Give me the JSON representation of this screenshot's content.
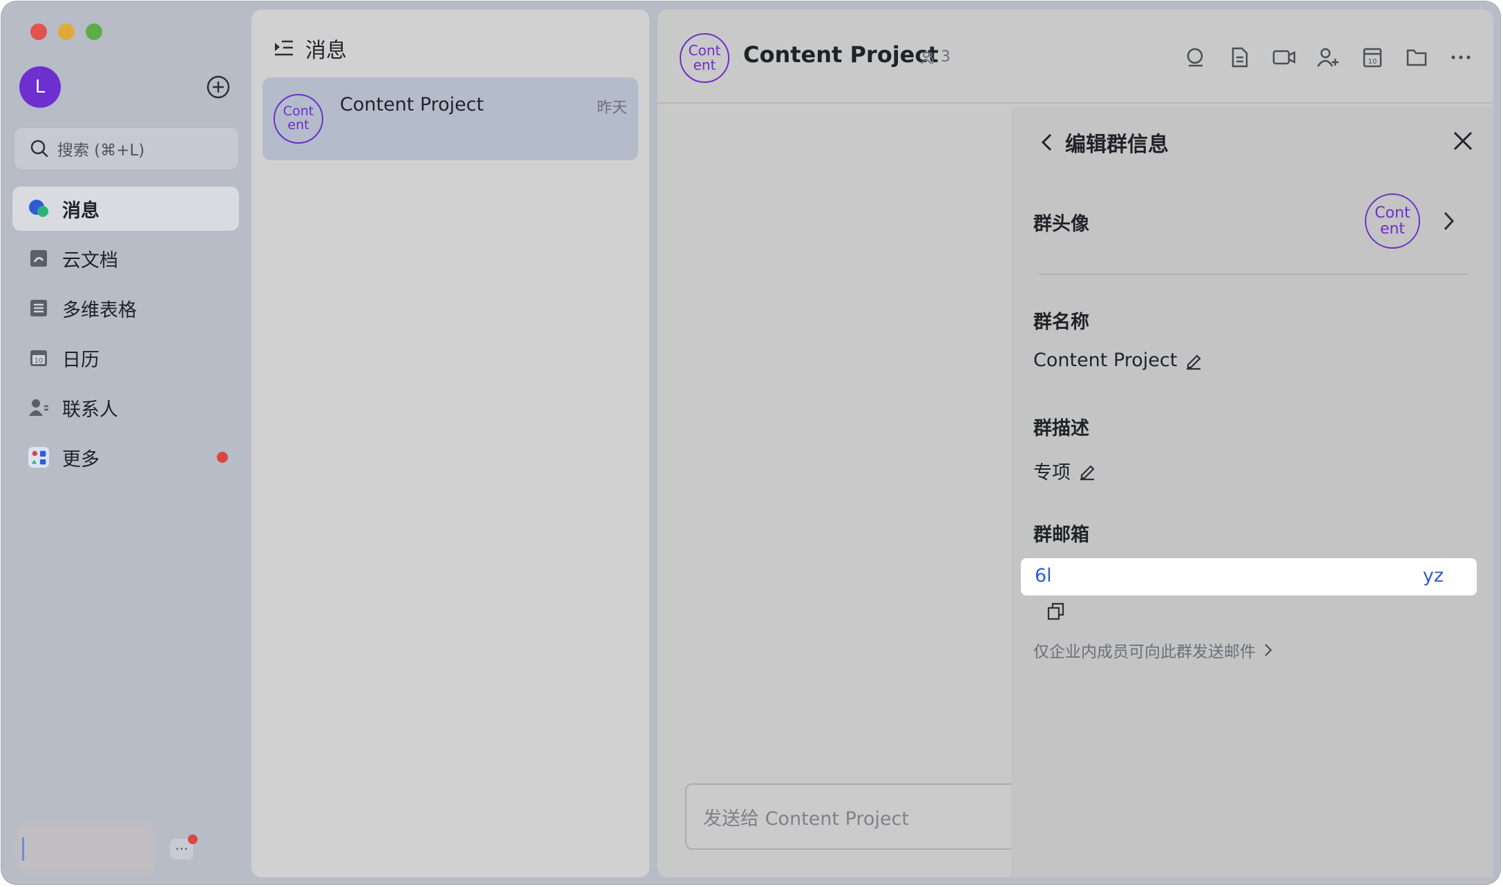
{
  "sidebar": {
    "user_initial": "L",
    "search_placeholder": "搜索 (⌘+L)",
    "items": [
      {
        "label": "消息",
        "icon": "chat-bubble-icon",
        "active": true
      },
      {
        "label": "云文档",
        "icon": "cloud-doc-icon"
      },
      {
        "label": "多维表格",
        "icon": "table-icon"
      },
      {
        "label": "日历",
        "icon": "calendar-icon"
      },
      {
        "label": "联系人",
        "icon": "contacts-icon"
      },
      {
        "label": "更多",
        "icon": "apps-icon",
        "has_badge": true
      }
    ],
    "more_mini_label": "···"
  },
  "list": {
    "title": "消息",
    "chat": {
      "avatar_text_1": "Cont",
      "avatar_text_2": "ent",
      "name": "Content Project",
      "time": "昨天"
    }
  },
  "chat": {
    "avatar_text_1": "Cont",
    "avatar_text_2": "ent",
    "title": "Content Project",
    "member_count": "3",
    "composer_placeholder": "发送给 Content Project",
    "header_icons": [
      "search-icon",
      "doc-icon",
      "video-icon",
      "add-member-icon",
      "calendar-icon",
      "folder-icon",
      "more-icon"
    ]
  },
  "drawer": {
    "title": "编辑群信息",
    "avatar_label": "群头像",
    "avatar_text_1": "Cont",
    "avatar_text_2": "ent",
    "name_label": "群名称",
    "name_value": "Content Project",
    "desc_label": "群描述",
    "desc_value": "专项",
    "mail_label": "群邮箱",
    "mail_prefix": "6l",
    "mail_suffix": "yz",
    "mail_note": "仅企业内成员可向此群发送邮件"
  },
  "colors": {
    "accent": "#6b2fc8",
    "link": "#2f5bd6",
    "badge": "#d9483e"
  }
}
